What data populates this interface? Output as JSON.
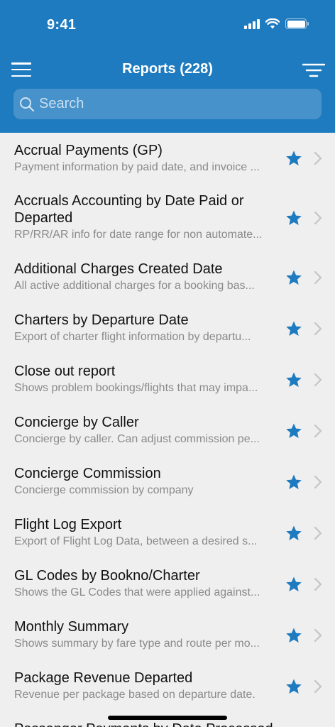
{
  "status_bar": {
    "time": "9:41"
  },
  "header": {
    "title": "Reports (228)"
  },
  "search": {
    "placeholder": "Search"
  },
  "reports": [
    {
      "title": "Accrual Payments (GP)",
      "subtitle": "Payment information by paid date, and invoice ...",
      "favorite": true
    },
    {
      "title": "Accruals Accounting by Date Paid or Departed",
      "subtitle": "RP/RR/AR info for date range for non automate...",
      "favorite": true
    },
    {
      "title": "Additional Charges Created Date",
      "subtitle": "All active additional charges for a booking bas...",
      "favorite": true
    },
    {
      "title": "Charters by Departure Date",
      "subtitle": "Export of charter flight information by departu...",
      "favorite": true
    },
    {
      "title": "Close out report",
      "subtitle": "Shows problem bookings/flights that may impa...",
      "favorite": true
    },
    {
      "title": "Concierge by Caller",
      "subtitle": "Concierge by caller. Can adjust commission pe...",
      "favorite": true
    },
    {
      "title": "Concierge Commission",
      "subtitle": "Concierge commission by company",
      "favorite": true
    },
    {
      "title": "Flight Log Export",
      "subtitle": "Export of Flight Log Data, between a desired s...",
      "favorite": true
    },
    {
      "title": "GL Codes by Bookno/Charter",
      "subtitle": "Shows the GL Codes that were applied against...",
      "favorite": true
    },
    {
      "title": "Monthly Summary",
      "subtitle": "Shows summary by fare type and route per mo...",
      "favorite": true
    },
    {
      "title": "Package Revenue Departed",
      "subtitle": "Revenue per package based on departure date.",
      "favorite": true
    },
    {
      "title": "Passenger Payments by Date Processed",
      "subtitle": "",
      "favorite": true
    }
  ],
  "colors": {
    "header": "#1f7bbf",
    "star": "#1f7bbf",
    "background": "#efefef"
  },
  "icons": [
    "menu-icon",
    "filter-icon",
    "search-icon",
    "star-icon",
    "chevron-right-icon"
  ]
}
